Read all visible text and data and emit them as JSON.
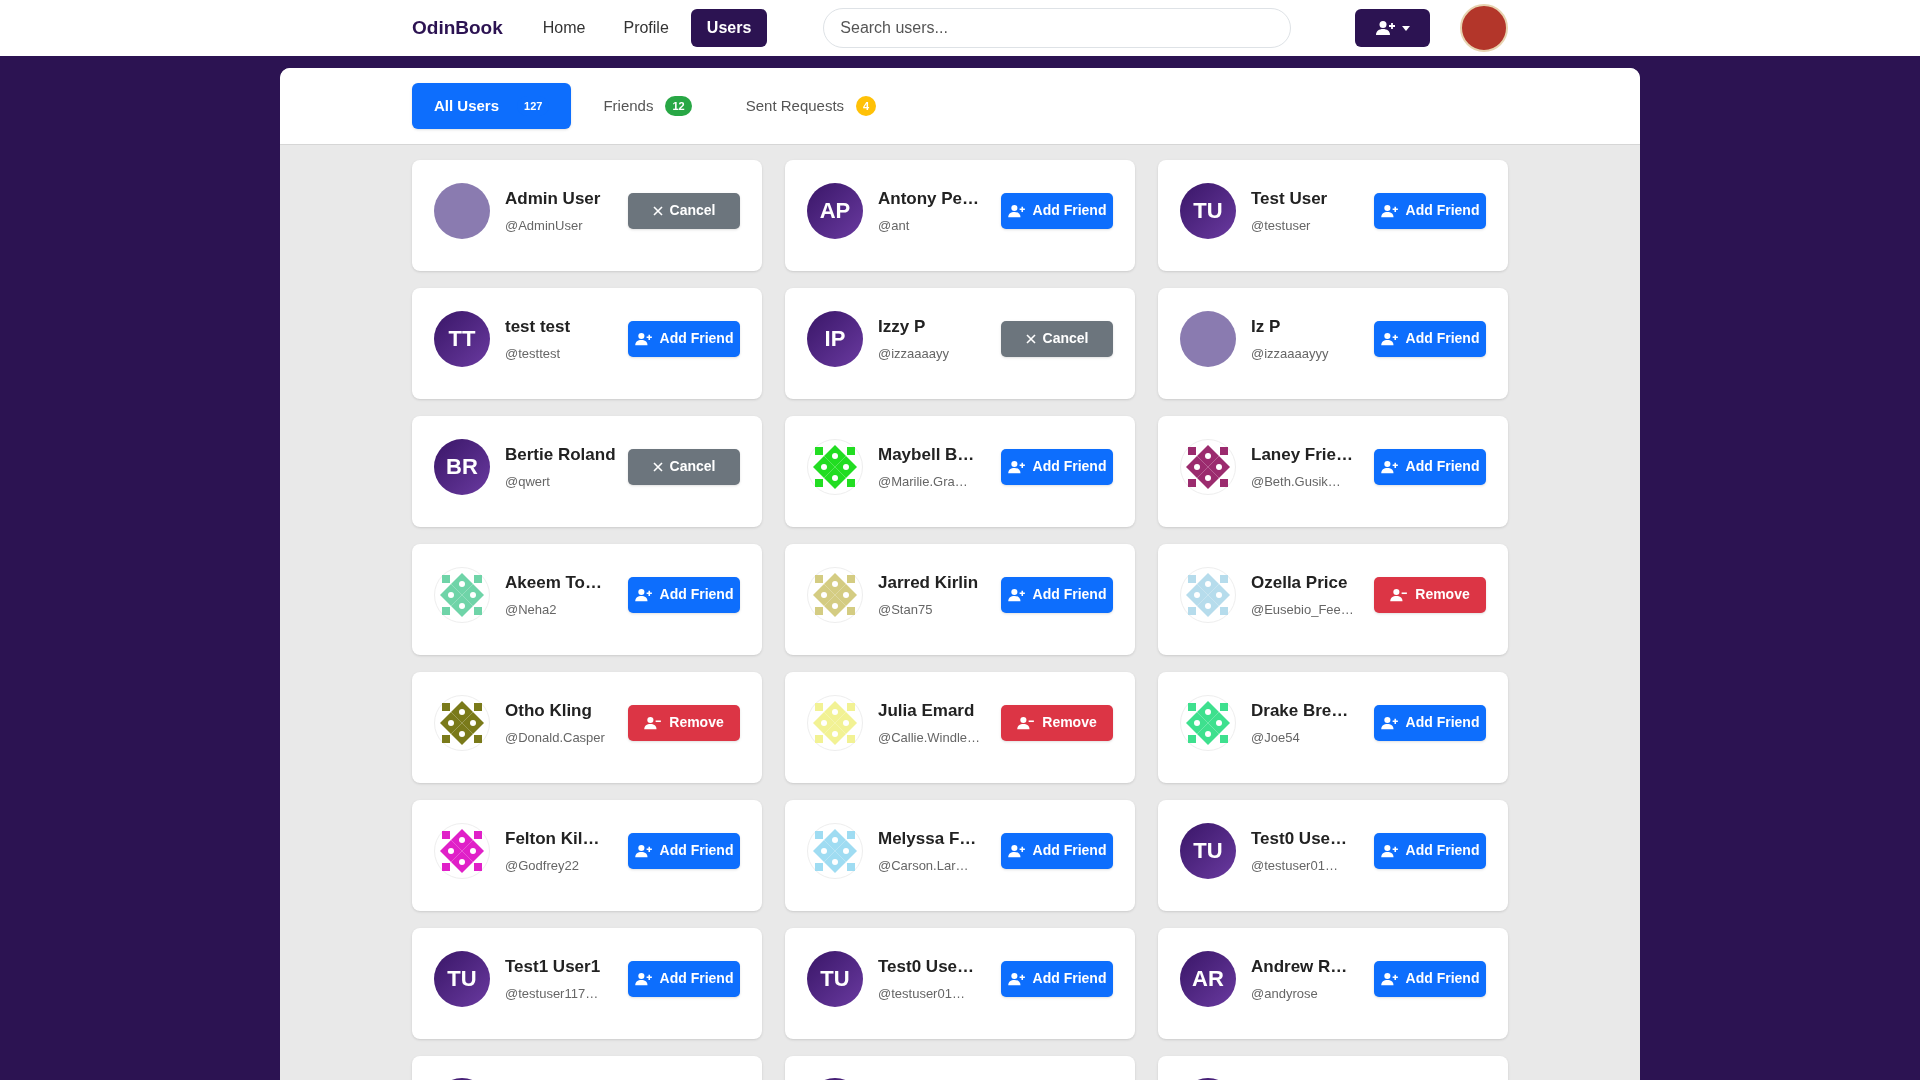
{
  "navbar": {
    "brand": "OdinBook",
    "links": [
      {
        "label": "Home",
        "selected": false
      },
      {
        "label": "Profile",
        "selected": false
      },
      {
        "label": "Users",
        "selected": true
      }
    ],
    "search": {
      "placeholder": "Search users..."
    }
  },
  "tabs": [
    {
      "label": "All Users",
      "count": "127",
      "selected": true,
      "color": "#0d6efd"
    },
    {
      "label": "Friends",
      "count": "12",
      "selected": false,
      "color": "#28a745"
    },
    {
      "label": "Sent Requests",
      "count": "4",
      "selected": false,
      "color": "#ffc107"
    }
  ],
  "users": [
    {
      "name": "Admin User",
      "handle": "@AdminUser",
      "avatar": {
        "kind": "photo"
      },
      "action": {
        "kind": "cancel",
        "label": "Cancel"
      }
    },
    {
      "name": "Antony Pe…",
      "handle": "@ant",
      "avatar": {
        "kind": "initials",
        "text": "AP"
      },
      "action": {
        "kind": "add",
        "label": "Add Friend"
      }
    },
    {
      "name": "Test User",
      "handle": "@testuser",
      "avatar": {
        "kind": "initials",
        "text": "TU"
      },
      "action": {
        "kind": "add",
        "label": "Add Friend"
      }
    },
    {
      "name": "test test",
      "handle": "@testtest",
      "avatar": {
        "kind": "initials",
        "text": "TT"
      },
      "action": {
        "kind": "add",
        "label": "Add Friend"
      }
    },
    {
      "name": "Izzy P",
      "handle": "@izzaaaayy",
      "avatar": {
        "kind": "initials",
        "text": "IP"
      },
      "action": {
        "kind": "cancel",
        "label": "Cancel"
      }
    },
    {
      "name": "Iz P",
      "handle": "@izzaaaayyy",
      "avatar": {
        "kind": "photo"
      },
      "action": {
        "kind": "add",
        "label": "Add Friend"
      }
    },
    {
      "name": "Bertie Roland",
      "handle": "@qwert",
      "avatar": {
        "kind": "initials",
        "text": "BR"
      },
      "action": {
        "kind": "cancel",
        "label": "Cancel"
      }
    },
    {
      "name": "Maybell B…",
      "handle": "@Marilie.Gra…",
      "avatar": {
        "kind": "identicon",
        "color": "#22dd22"
      },
      "action": {
        "kind": "add",
        "label": "Add Friend"
      }
    },
    {
      "name": "Laney Frie…",
      "handle": "@Beth.Gusik…",
      "avatar": {
        "kind": "identicon",
        "color": "#9b2b6e"
      },
      "action": {
        "kind": "add",
        "label": "Add Friend"
      }
    },
    {
      "name": "Akeem To…",
      "handle": "@Neha2",
      "avatar": {
        "kind": "identicon",
        "color": "#6fd4a8"
      },
      "action": {
        "kind": "add",
        "label": "Add Friend"
      }
    },
    {
      "name": "Jarred Kirlin",
      "handle": "@Stan75",
      "avatar": {
        "kind": "identicon",
        "color": "#d4cc82"
      },
      "action": {
        "kind": "add",
        "label": "Add Friend"
      }
    },
    {
      "name": "Ozella Price",
      "handle": "@Eusebio_Fee…",
      "avatar": {
        "kind": "identicon",
        "color": "#b6dcec"
      },
      "action": {
        "kind": "remove",
        "label": "Remove"
      }
    },
    {
      "name": "Otho Kling",
      "handle": "@Donald.Casper",
      "avatar": {
        "kind": "identicon",
        "color": "#7a7a1a"
      },
      "action": {
        "kind": "remove",
        "label": "Remove"
      }
    },
    {
      "name": "Julia Emard",
      "handle": "@Callie.Windle…",
      "avatar": {
        "kind": "identicon",
        "color": "#f2f294"
      },
      "action": {
        "kind": "remove",
        "label": "Remove"
      }
    },
    {
      "name": "Drake Bre…",
      "handle": "@Joe54",
      "avatar": {
        "kind": "identicon",
        "color": "#3ee08e"
      },
      "action": {
        "kind": "add",
        "label": "Add Friend"
      }
    },
    {
      "name": "Felton Kil…",
      "handle": "@Godfrey22",
      "avatar": {
        "kind": "identicon",
        "color": "#e020c8"
      },
      "action": {
        "kind": "add",
        "label": "Add Friend"
      }
    },
    {
      "name": "Melyssa F…",
      "handle": "@Carson.Lar…",
      "avatar": {
        "kind": "identicon",
        "color": "#9fdcf2"
      },
      "action": {
        "kind": "add",
        "label": "Add Friend"
      }
    },
    {
      "name": "Test0 Use…",
      "handle": "@testuser01…",
      "avatar": {
        "kind": "initials",
        "text": "TU"
      },
      "action": {
        "kind": "add",
        "label": "Add Friend"
      }
    },
    {
      "name": "Test1 User1",
      "handle": "@testuser117…",
      "avatar": {
        "kind": "initials",
        "text": "TU"
      },
      "action": {
        "kind": "add",
        "label": "Add Friend"
      }
    },
    {
      "name": "Test0 Use…",
      "handle": "@testuser01…",
      "avatar": {
        "kind": "initials",
        "text": "TU"
      },
      "action": {
        "kind": "add",
        "label": "Add Friend"
      }
    },
    {
      "name": "Andrew R…",
      "handle": "@andyrose",
      "avatar": {
        "kind": "initials",
        "text": "AR"
      },
      "action": {
        "kind": "add",
        "label": "Add Friend"
      }
    }
  ],
  "partial_cards": [
    {
      "avatar": {
        "kind": "initials"
      }
    },
    {
      "avatar": {
        "kind": "initials"
      }
    },
    {
      "avatar": {
        "kind": "initials"
      }
    }
  ]
}
